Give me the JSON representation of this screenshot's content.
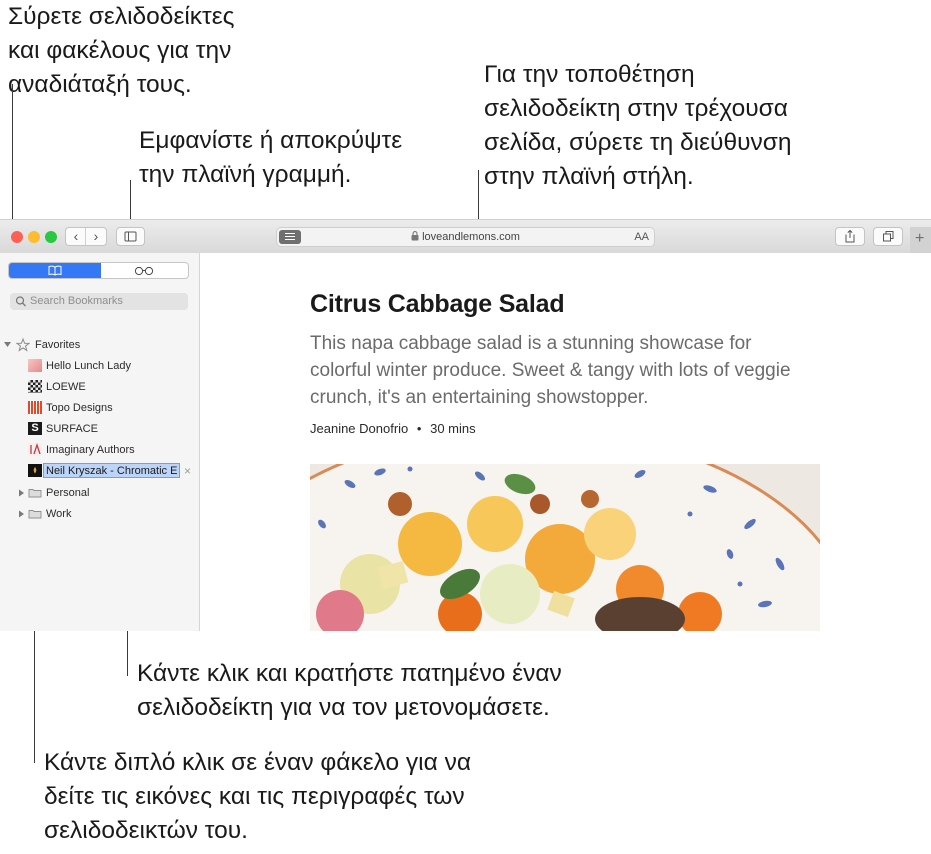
{
  "callouts": {
    "drag_reorder": "Σύρετε σελιδοδείκτες\nκαι φακέλους για την\nαναδιάταξή τους.",
    "sidebar_toggle": "Εμφανίστε ή αποκρύψτε\nτην πλαϊνή γραμμή.",
    "add_bookmark": "Για την τοποθέτηση\nσελιδοδείκτη στην τρέχουσα\nσελίδα, σύρετε τη διεύθυνση\nστην πλαϊνή στήλη.",
    "rename": "Κάντε κλικ και κρατήστε πατημένο έναν\nσελιδοδείκτη για να τον μετονομάσετε.",
    "double_click": "Κάντε διπλό κλικ σε έναν φάκελο για να\nδείτε τις εικόνες και τις περιγραφές των\nσελιδοδεικτών του."
  },
  "toolbar": {
    "address": "loveandlemons.com",
    "text_size": "AA",
    "back_glyph": "‹",
    "forward_glyph": "›",
    "new_tab_glyph": "+"
  },
  "sidebar": {
    "search_placeholder": "Search Bookmarks",
    "favorites_label": "Favorites",
    "bookmarks": [
      {
        "label": "Hello Lunch Lady"
      },
      {
        "label": "LOEWE"
      },
      {
        "label": "Topo Designs"
      },
      {
        "label": "SURFACE"
      },
      {
        "label": "Imaginary Authors"
      }
    ],
    "editing_value": "Neil Kryszak - Chromatic E",
    "clear_glyph": "×",
    "folders": [
      {
        "label": "Personal"
      },
      {
        "label": "Work"
      }
    ]
  },
  "article": {
    "title": "Citrus Cabbage Salad",
    "subtitle": "This napa cabbage salad is a stunning showcase for colorful winter produce. Sweet & tangy with lots of veggie crunch, it's an entertaining showstopper.",
    "author": "Jeanine Donofrio",
    "separator": "•",
    "time": "30 mins"
  },
  "colors": {
    "close": "#fe5f57",
    "minimize": "#febc2e",
    "zoom": "#28c840",
    "accent": "#3478f6",
    "selection": "#bcd4f8"
  }
}
